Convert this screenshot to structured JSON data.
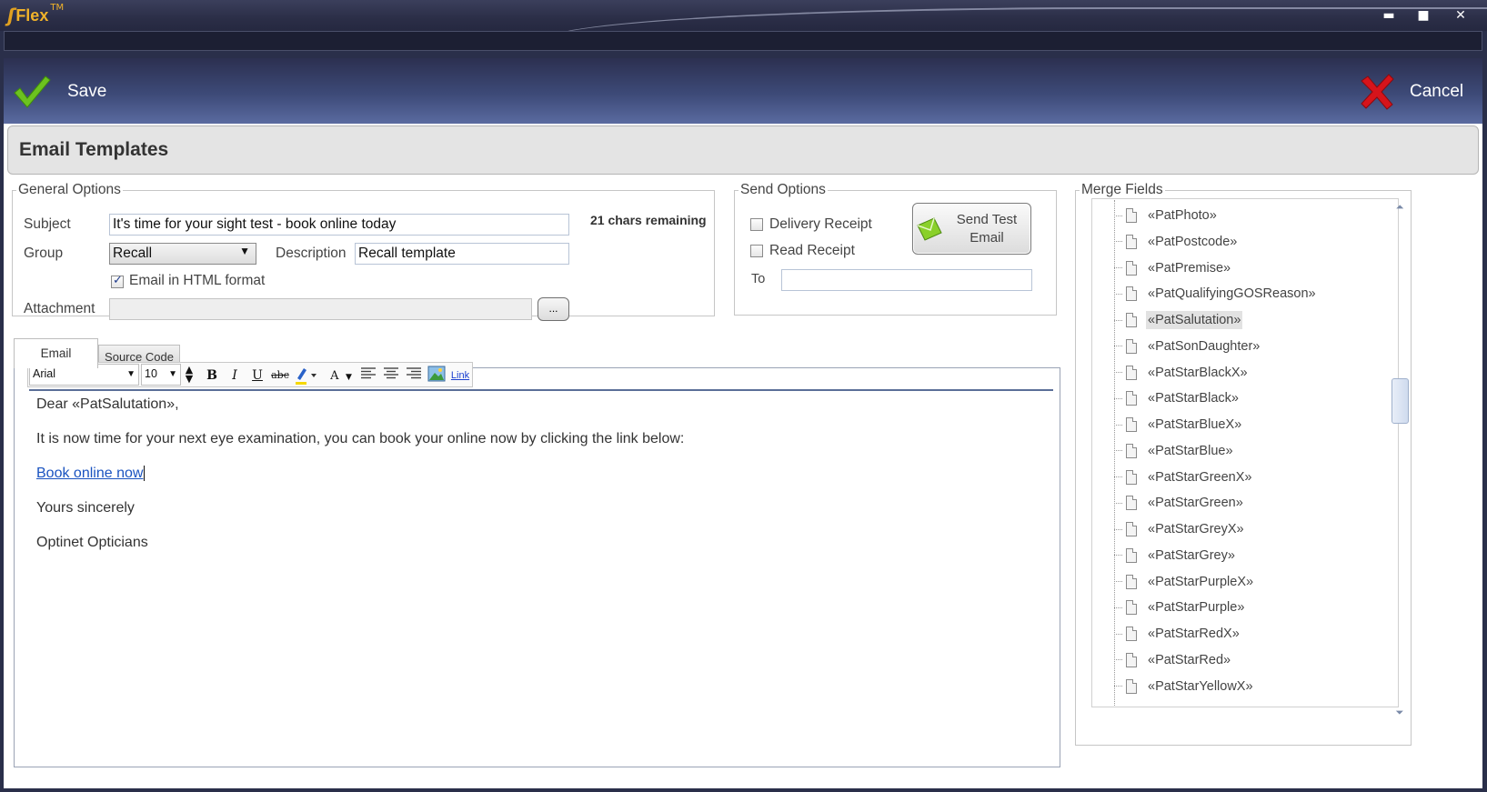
{
  "app": {
    "name": "Flex",
    "trademark": "TM",
    "window_controls": {
      "minimize": "▬",
      "maximize": "■",
      "close": "✕"
    }
  },
  "toolbar": {
    "save_label": "Save",
    "cancel_label": "Cancel",
    "save_icon": "check-icon",
    "cancel_icon": "x-icon"
  },
  "page": {
    "title": "Email Templates"
  },
  "general_options": {
    "legend": "General Options",
    "subject_label": "Subject",
    "subject_value": "It's time for your sight test - book online today",
    "chars_remaining": "21 chars remaining",
    "group_label": "Group",
    "group_value": "Recall",
    "description_label": "Description",
    "description_value": "Recall template",
    "html_format_label": "Email in HTML format",
    "html_format_checked": true,
    "attachment_label": "Attachment",
    "attachment_value": "",
    "browse_label": "..."
  },
  "send_options": {
    "legend": "Send Options",
    "delivery_receipt_label": "Delivery Receipt",
    "delivery_receipt_checked": false,
    "read_receipt_label": "Read Receipt",
    "read_receipt_checked": false,
    "to_label": "To",
    "to_value": "",
    "send_test_label_line1": "Send Test",
    "send_test_label_line2": "Email"
  },
  "editor": {
    "tabs": [
      {
        "label": "Email",
        "active": true
      },
      {
        "label": "Source Code",
        "active": false
      }
    ],
    "font_name": "Arial",
    "font_size": "10",
    "bold": "B",
    "italic": "I",
    "underline": "U",
    "strike": "abc",
    "font_color": "A",
    "link": "Link",
    "content": {
      "line1": "Dear «PatSalutation»,",
      "line2": "It is now time for your next eye examination, you can book your online now by clicking the link below:",
      "link_text": "Book online now",
      "line4": "Yours sincerely",
      "line5": "Optinet Opticians"
    }
  },
  "merge_fields": {
    "legend": "Merge Fields",
    "items": [
      "«PatPhoto»",
      "«PatPostcode»",
      "«PatPremise»",
      "«PatQualifyingGOSReason»",
      "«PatSalutation»",
      "«PatSonDaughter»",
      "«PatStarBlackX»",
      "«PatStarBlack»",
      "«PatStarBlueX»",
      "«PatStarBlue»",
      "«PatStarGreenX»",
      "«PatStarGreen»",
      "«PatStarGreyX»",
      "«PatStarGrey»",
      "«PatStarPurpleX»",
      "«PatStarPurple»",
      "«PatStarRedX»",
      "«PatStarRed»",
      "«PatStarYellowX»"
    ],
    "selected_index": 4
  },
  "colors": {
    "save_check": "#6cc21f",
    "cancel_x": "#d6141b",
    "link": "#1a53c0",
    "brand": "#f0b22a"
  }
}
